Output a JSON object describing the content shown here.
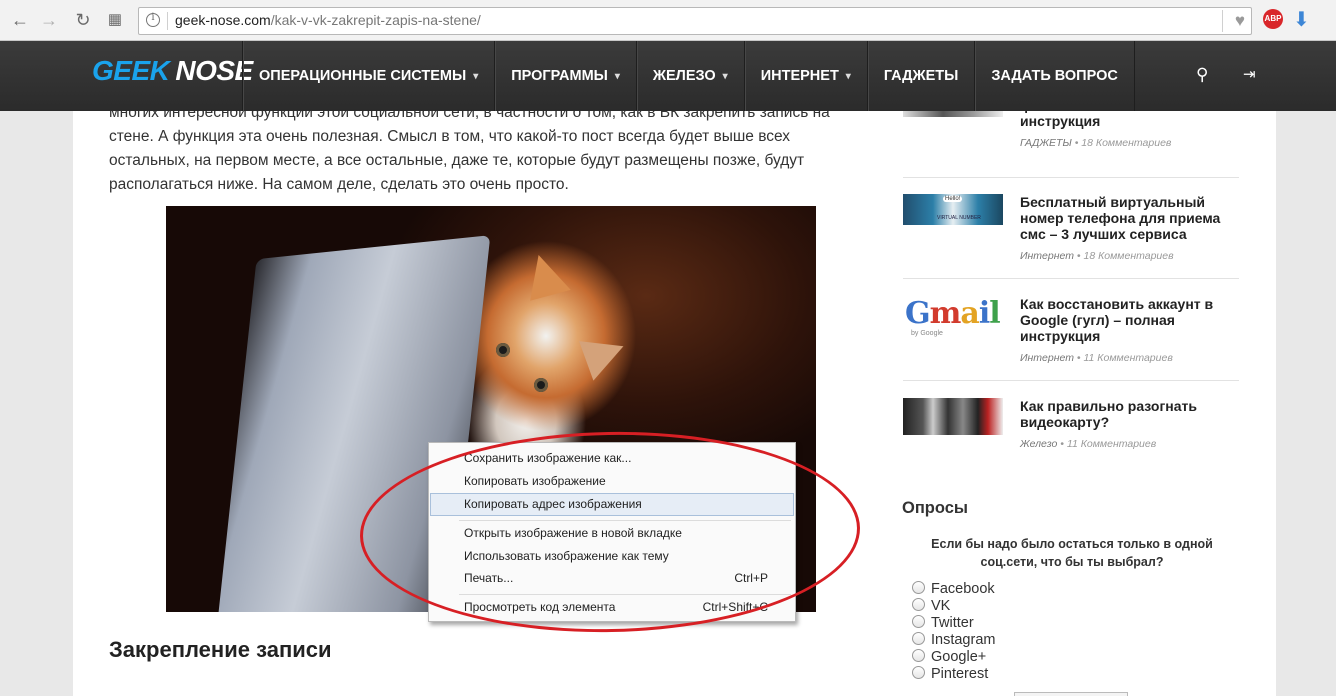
{
  "browser": {
    "url_host": "geek-nose.com",
    "url_path": "/kak-v-vk-zakrepit-zapis-na-stene/",
    "abp_label": "ABP",
    "icons": [
      "back-icon",
      "forward-icon",
      "reload-icon",
      "apps-icon",
      "info-icon",
      "bookmark-heart-icon",
      "adblock-plus-icon",
      "download-icon"
    ]
  },
  "site": {
    "logo_first": "GEEK",
    "logo_second": "NOSE",
    "menu": [
      {
        "label": "ОПЕРАЦИОННЫЕ СИСТЕМЫ",
        "has_dropdown": true
      },
      {
        "label": "ПРОГРАММЫ",
        "has_dropdown": true
      },
      {
        "label": "ЖЕЛЕЗО",
        "has_dropdown": true
      },
      {
        "label": "ИНТЕРНЕТ",
        "has_dropdown": true
      },
      {
        "label": "ГАДЖЕТЫ",
        "has_dropdown": false
      },
      {
        "label": "ЗАДАТЬ ВОПРОС",
        "has_dropdown": false
      }
    ],
    "header_icons": [
      "search-icon",
      "login-icon"
    ],
    "brand_color": "#1aa3ec",
    "header_color": "#333333"
  },
  "article": {
    "paragraph_cut": "многих интересной функции этой социальной сети, в частности о том, как в ВК закрепить запись на",
    "paragraph": "стене. А функция эта очень полезная. Смысл в том, что какой-то пост всегда будет выше всех остальных, на первом месте, а все остальные, даже те, которые будут размещены позже, будут располагаться ниже. На самом деле, сделать это очень просто.",
    "heading": "Закрепление записи"
  },
  "context_menu": {
    "items": [
      {
        "label": "Сохранить изображение как...",
        "shortcut": ""
      },
      {
        "label": "Копировать изображение",
        "shortcut": ""
      },
      {
        "label": "Копировать адрес изображения",
        "shortcut": "",
        "highlighted": true
      },
      {
        "label": "Открыть изображение в новой вкладке",
        "shortcut": ""
      },
      {
        "label": "Использовать изображение как тему",
        "shortcut": ""
      },
      {
        "label": "Печать...",
        "shortcut": "Ctrl+P"
      },
      {
        "label": "Просмотреть код элемента",
        "shortcut": "Ctrl+Shift+C"
      }
    ],
    "annotation_color": "#d71f24"
  },
  "sidebar": {
    "posts": [
      {
        "title": "флешки — пошаговая инструкция",
        "category": "ГАДЖЕТЫ",
        "comments": "18 Комментариев"
      },
      {
        "title": "Бесплатный виртуальный номер телефона для приема смс – 3 лучших сервиса",
        "category": "Интернет",
        "comments": "18 Комментариев"
      },
      {
        "title": "Как восстановить аккаунт в Google (гугл) – полная инструкция",
        "category": "Интернет",
        "comments": "11 Комментариев"
      },
      {
        "title": "Как правильно разогнать видеокарту?",
        "category": "Железо",
        "comments": "11 Комментариев"
      }
    ],
    "polls": {
      "title": "Опросы",
      "question": "Если бы надо было остаться только в одной соц.сети, что бы ты выбрал?",
      "options": [
        "Facebook",
        "VK",
        "Twitter",
        "Instagram",
        "Google+",
        "Pinterest"
      ]
    }
  },
  "thumb_text": {
    "gmail": "Gmail",
    "by_google": "by Google",
    "hello": "Hello!",
    "virtual_number": "VIRTUAL NUMBER"
  }
}
